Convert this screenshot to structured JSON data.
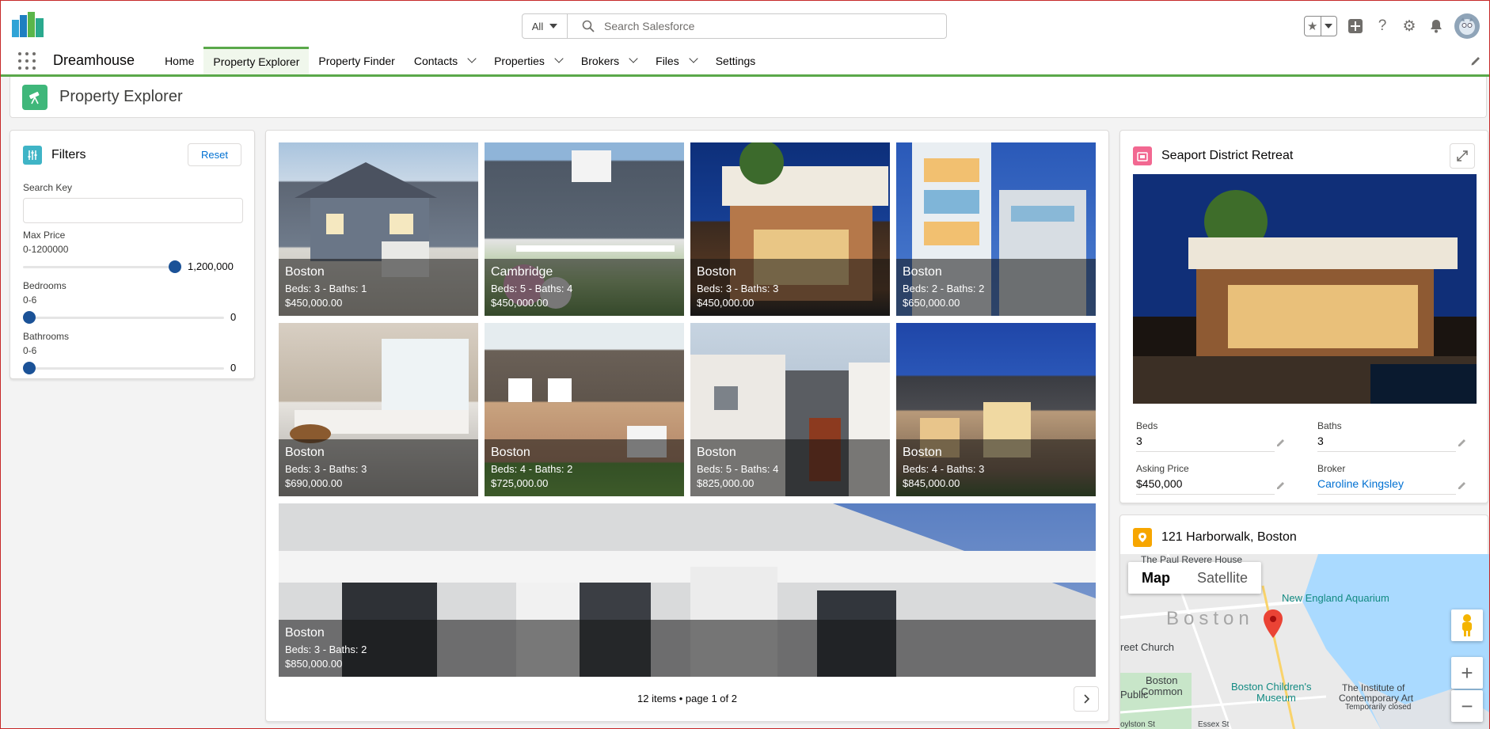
{
  "header": {
    "search_scope": "All",
    "search_placeholder": "Search Salesforce"
  },
  "nav": {
    "app_name": "Dreamhouse",
    "items": [
      {
        "label": "Home",
        "has_menu": false,
        "active": false
      },
      {
        "label": "Property Explorer",
        "has_menu": false,
        "active": true
      },
      {
        "label": "Property Finder",
        "has_menu": false,
        "active": false
      },
      {
        "label": "Contacts",
        "has_menu": true,
        "active": false
      },
      {
        "label": "Properties",
        "has_menu": true,
        "active": false
      },
      {
        "label": "Brokers",
        "has_menu": true,
        "active": false
      },
      {
        "label": "Files",
        "has_menu": true,
        "active": false
      },
      {
        "label": "Settings",
        "has_menu": false,
        "active": false
      }
    ]
  },
  "page": {
    "title": "Property Explorer"
  },
  "filters": {
    "title": "Filters",
    "reset_label": "Reset",
    "search_key_label": "Search Key",
    "search_key_value": "",
    "max_price": {
      "label": "Max Price",
      "range": "0-1200000",
      "value": "1,200,000",
      "fraction": 1.0
    },
    "bedrooms": {
      "label": "Bedrooms",
      "range": "0-6",
      "value": "0",
      "fraction": 0.0
    },
    "bathrooms": {
      "label": "Bathrooms",
      "range": "0-6",
      "value": "0",
      "fraction": 0.0
    }
  },
  "gallery": {
    "properties": [
      {
        "city": "Boston",
        "specs": "Beds: 3 - Baths: 1",
        "price": "$450,000.00"
      },
      {
        "city": "Cambridge",
        "specs": "Beds: 5 - Baths: 4",
        "price": "$450,000.00"
      },
      {
        "city": "Boston",
        "specs": "Beds: 3 - Baths: 3",
        "price": "$450,000.00"
      },
      {
        "city": "Boston",
        "specs": "Beds: 2 - Baths: 2",
        "price": "$650,000.00"
      },
      {
        "city": "Boston",
        "specs": "Beds: 3 - Baths: 3",
        "price": "$690,000.00"
      },
      {
        "city": "Boston",
        "specs": "Beds: 4 - Baths: 2",
        "price": "$725,000.00"
      },
      {
        "city": "Boston",
        "specs": "Beds: 5 - Baths: 4",
        "price": "$825,000.00"
      },
      {
        "city": "Boston",
        "specs": "Beds: 4 - Baths: 3",
        "price": "$845,000.00"
      },
      {
        "city": "Boston",
        "specs": "Beds: 3 - Baths: 2",
        "price": "$850,000.00"
      }
    ],
    "pager_text": "12 items • page 1 of 2"
  },
  "detail": {
    "title": "Seaport District Retreat",
    "beds_label": "Beds",
    "beds_value": "3",
    "baths_label": "Baths",
    "baths_value": "3",
    "price_label": "Asking Price",
    "price_value": "$450,000",
    "broker_label": "Broker",
    "broker_value": "Caroline Kingsley"
  },
  "map": {
    "title": "121 Harborwalk, Boston",
    "tab_map": "Map",
    "tab_satellite": "Satellite",
    "labels": {
      "revere": "The Paul Revere House",
      "aquarium": "New England Aquarium",
      "city": "Boston",
      "church": "reet Church",
      "common": "Boston\nCommon",
      "common_1": "Boston",
      "common_2": "Common",
      "public": "Public",
      "museum_1": "Boston Children's",
      "museum_2": "Museum",
      "institute_1": "The Institute of",
      "institute_2": "Contemporary Art",
      "institute_3": "Temporarily closed",
      "street_1": "oylston St",
      "street_2": "Essex St"
    }
  }
}
